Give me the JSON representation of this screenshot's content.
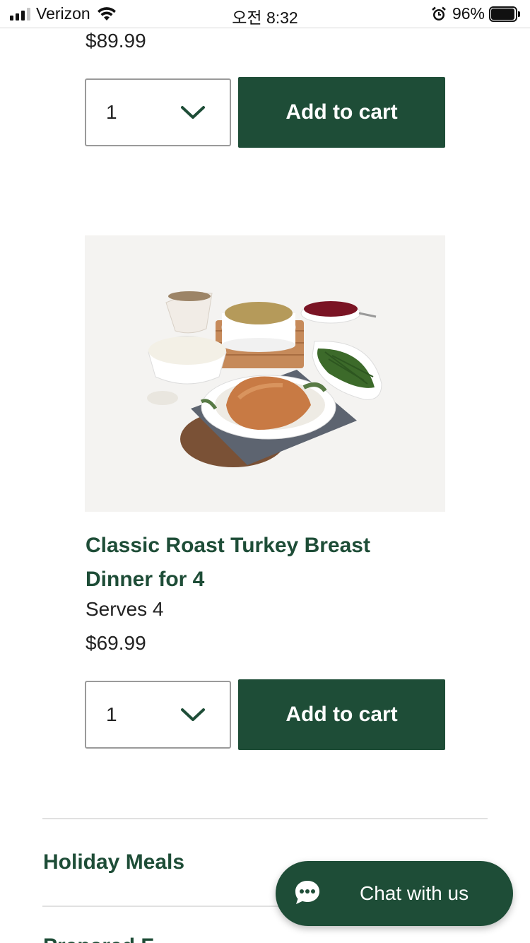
{
  "status_bar": {
    "carrier": "Verizon",
    "time": "오전 8:32",
    "battery_percent": "96%"
  },
  "products": [
    {
      "price": "$89.99",
      "quantity": "1",
      "add_to_cart_label": "Add to cart"
    },
    {
      "name": "Classic Roast Turkey Breast Dinner for 4",
      "serves": "Serves 4",
      "price": "$69.99",
      "quantity": "1",
      "add_to_cart_label": "Add to cart"
    }
  ],
  "footer_nav": {
    "items": [
      "Holiday Meals",
      "Prepared F"
    ]
  },
  "chat": {
    "label": "Chat with us"
  },
  "colors": {
    "brand_green": "#1e4d37",
    "text": "#222222",
    "border": "#9a9a9a"
  },
  "icons": [
    "signal-icon",
    "wifi-icon",
    "alarm-icon",
    "battery-icon",
    "chevron-down-icon",
    "chat-bubble-icon"
  ]
}
